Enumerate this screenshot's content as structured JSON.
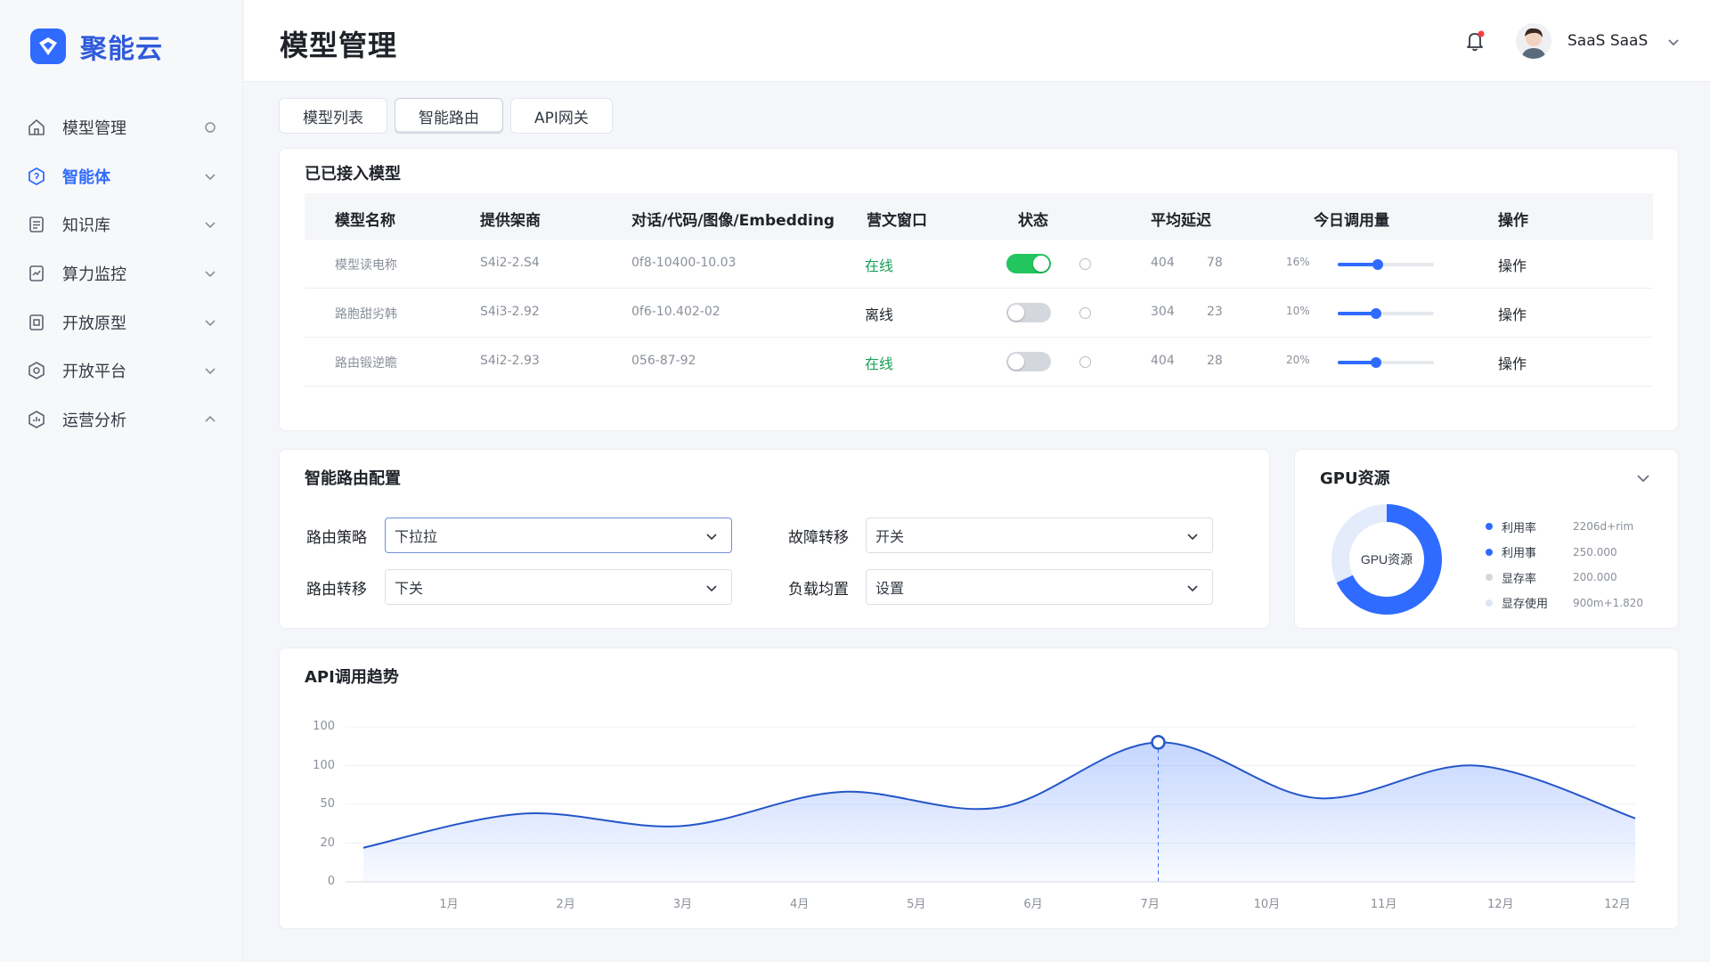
{
  "app": {
    "brand": "聚能云"
  },
  "sidebar": {
    "items": [
      {
        "label": "模型管理",
        "icon": "home-icon",
        "trail": "circle",
        "active": false
      },
      {
        "label": "智能体",
        "icon": "agent-icon",
        "trail": "down",
        "active": true
      },
      {
        "label": "知识库",
        "icon": "document-icon",
        "trail": "down",
        "active": false
      },
      {
        "label": "算力监控",
        "icon": "monitor-icon",
        "trail": "down",
        "active": false
      },
      {
        "label": "开放原型",
        "icon": "prototype-icon",
        "trail": "down",
        "active": false
      },
      {
        "label": "开放平台",
        "icon": "platform-icon",
        "trail": "down",
        "active": false
      },
      {
        "label": "运营分析",
        "icon": "analytics-icon",
        "trail": "up",
        "active": false
      }
    ]
  },
  "header": {
    "title": "模型管理",
    "user": "SaaS SaaS"
  },
  "tabs": [
    {
      "label": "模型列表",
      "active": false
    },
    {
      "label": "智能路由",
      "active": true
    },
    {
      "label": "API网关",
      "active": false
    }
  ],
  "models": {
    "title": "已已接入模型",
    "columns": [
      "模型名称",
      "提供架商",
      "对话/代码/图像/Embedding",
      "营文窗口",
      "状态",
      "平均延迟",
      "今日调用量",
      "操作"
    ],
    "rows": [
      {
        "name": "模型读电称",
        "provider": "S4i2-2.S4",
        "caps": "0f8-10400-10.03",
        "status": "在线",
        "online": true,
        "toggle": true,
        "latency": "404",
        "latency2": "78",
        "usage": "16%",
        "usage_fraction": 0.42,
        "op": "操作"
      },
      {
        "name": "路胞甜劣韩",
        "provider": "S4i3-2.92",
        "caps": "0f6-10.402-02",
        "status": "离线",
        "online": false,
        "toggle": false,
        "latency": "304",
        "latency2": "23",
        "usage": "10%",
        "usage_fraction": 0.4,
        "op": "操作"
      },
      {
        "name": "路由锻逆瞻",
        "provider": "S4i2-2.93",
        "caps": "056-87-92",
        "status": "在线",
        "online": true,
        "toggle": false,
        "latency": "404",
        "latency2": "28",
        "usage": "20%",
        "usage_fraction": 0.4,
        "op": "操作"
      }
    ]
  },
  "routing": {
    "title": "智能路由配置",
    "fields": [
      {
        "label": "路由策略",
        "value": "下拉拉"
      },
      {
        "label": "故障转移",
        "value": "开关"
      },
      {
        "label": "路由转移",
        "value": "下关"
      },
      {
        "label": "负载均置",
        "value": "设置"
      }
    ]
  },
  "gpu": {
    "title": "GPU资源",
    "center": "GPU资源",
    "utilization_fraction": 0.68,
    "legend": [
      {
        "name": "利用率",
        "value": "2206d+rim",
        "color": "#2f6bff"
      },
      {
        "name": "利用事",
        "value": "250.000",
        "color": "#2f6bff"
      },
      {
        "name": "显存率",
        "value": "200.000",
        "color": "#d4d8de"
      },
      {
        "name": "显存使用",
        "value": "900m+1.820",
        "color": "#dde6f5"
      }
    ]
  },
  "chart_data": {
    "type": "area",
    "title": "API调用趋势",
    "y_tick_labels": [
      "100",
      "100",
      "50",
      "20",
      "0"
    ],
    "categories": [
      "1月",
      "2月",
      "3月",
      "4月",
      "5月",
      "6月",
      "7月",
      "10月",
      "11月",
      "12月",
      "12月"
    ],
    "series": [
      {
        "values": [
          22,
          44,
          36,
          58,
          48,
          90,
          54,
          75,
          41
        ]
      }
    ],
    "ylim": [
      0,
      100
    ],
    "highlight": {
      "category": "6月",
      "value": 90
    },
    "grid": true,
    "color": "#2f6bff"
  }
}
